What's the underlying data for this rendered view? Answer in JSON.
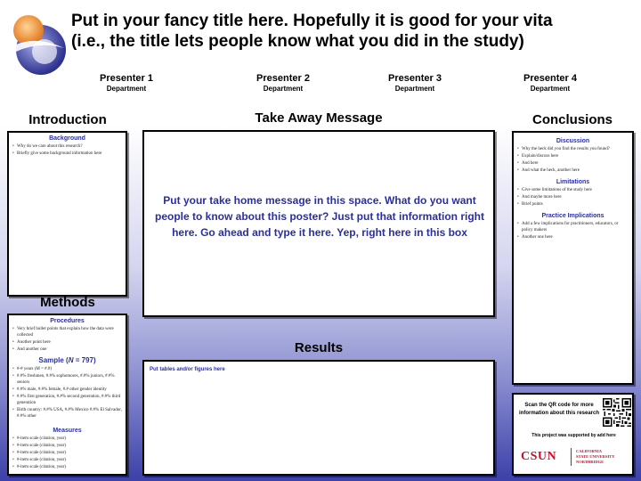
{
  "header": {
    "title_line1": "Put in your fancy title here. Hopefully it is good for your vita",
    "title_line2": "(i.e., the title lets people know what you did in the study)"
  },
  "presenters": [
    {
      "name": "Presenter 1",
      "department": "Department"
    },
    {
      "name": "Presenter 2",
      "department": "Department"
    },
    {
      "name": "Presenter 3",
      "department": "Department"
    },
    {
      "name": "Presenter 4",
      "department": "Department"
    }
  ],
  "introduction": {
    "heading": "Introduction",
    "subheading": "Background",
    "bullets": [
      "Why do we care about this research?",
      "Briefly give some background information here"
    ]
  },
  "methods": {
    "heading": "Methods",
    "procedures_heading": "Procedures",
    "procedures_bullets": [
      "Very brief bullet points that explain how the data were collected",
      "Another point here",
      "And another one"
    ],
    "sample_heading_prefix": "Sample (",
    "sample_heading_n": "N",
    "sample_heading_suffix": " = 797)",
    "sample_bullets": [
      "#-# years (M = #.#)",
      "#.#% freshmen, #.#% sophomores, #.#% juniors, #.#% seniors",
      "#.#% male, #.#% female, #.# other gender identity",
      "#.#% first generation, #.#% second generation, #.#% third generation",
      "Birth country: #.#% USA, #.#% Mexico #.#% El Salvador, #.#% other"
    ],
    "measures_heading": "Measures",
    "measures_bullets": [
      "#-item scale (citation, year)",
      "#-item scale (citation, year)",
      "#-item scale (citation, year)",
      "#-item scale (citation, year)",
      "#-item scale (citation, year)"
    ]
  },
  "takeaway": {
    "heading": "Take Away Message",
    "text": "Put your take home message in this space. What do you want people to know about this poster? Just put that information right here. Go ahead and type it here. Yep, right here in this box"
  },
  "results": {
    "heading": "Results",
    "label": "Put tables and/or figures here"
  },
  "conclusions": {
    "heading": "Conclusions",
    "discussion_heading": "Discussion",
    "discussion_bullets": [
      "Why the heck did you find the results you found?",
      "Explain/discuss here",
      "And here",
      "And what the heck, another here"
    ],
    "limitations_heading": "Limitations",
    "limitations_bullets": [
      "Give some limitations of the study here",
      "And maybe more here",
      "Brief points"
    ],
    "implications_heading": "Practice Implications",
    "implications_bullets": [
      "Add a few implications for practitioners, educators, or policy makers",
      "Another one here"
    ]
  },
  "footer": {
    "qr_text": "Scan the QR code for more information about this research",
    "support_text": "This project was supported by add here",
    "csun_logo": "CSUN",
    "csun_sub1": "CALIFORNIA",
    "csun_sub2": "STATE UNIVERSITY",
    "csun_sub3": "NORTHRIDGE"
  },
  "colors": {
    "accent": "#2b2f9a",
    "csun_red": "#c8102e",
    "gradient_bottom": "#3c40a8"
  }
}
